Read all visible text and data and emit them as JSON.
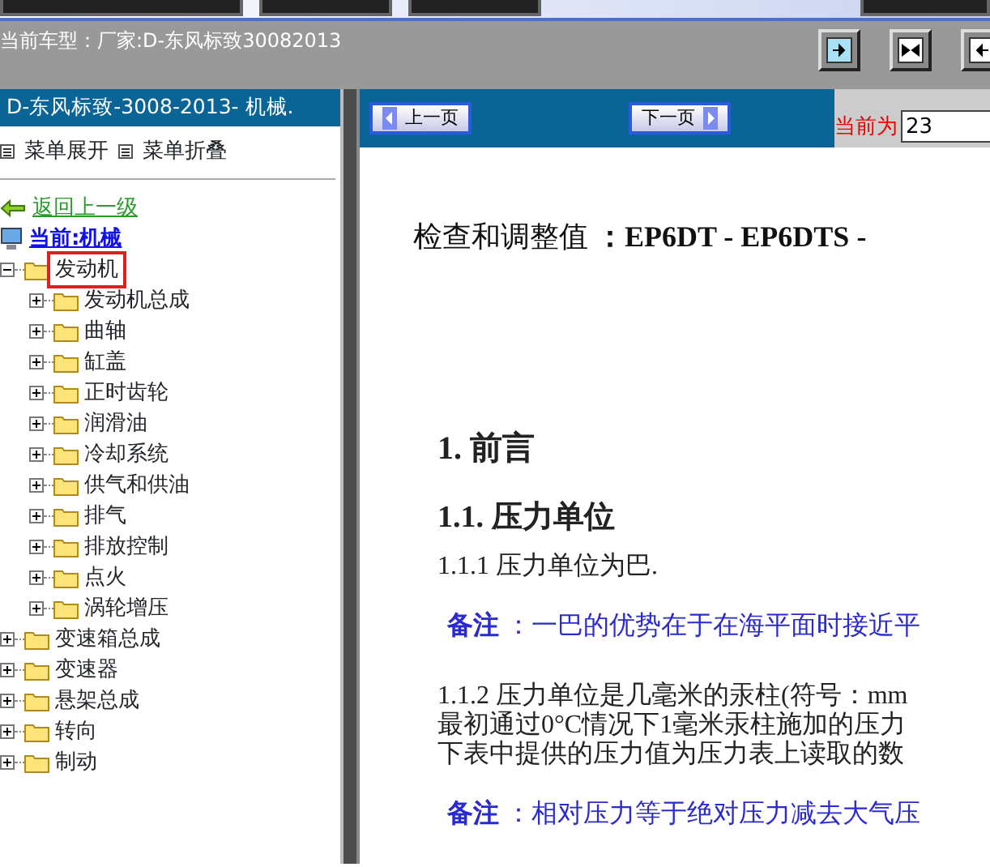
{
  "vehicle_label": "当前车型：厂家:D-东风标致30082013",
  "view_buttons": [
    {
      "kind": "right",
      "selected": true
    },
    {
      "kind": "both",
      "selected": false
    },
    {
      "kind": "left",
      "selected": false
    }
  ],
  "sidebar": {
    "title": "D-东风标致-3008-2013- 机械.",
    "menu_actions": [
      "菜单展开",
      "菜单折叠"
    ],
    "back_link": "返回上一级",
    "current": "当前:机械",
    "tree": [
      {
        "label": "发动机",
        "expanded": true,
        "selected": true,
        "children": [
          {
            "label": "发动机总成",
            "expanded": false,
            "selected": false
          },
          {
            "label": "曲轴",
            "expanded": false,
            "selected": false
          },
          {
            "label": "缸盖",
            "expanded": false,
            "selected": false
          },
          {
            "label": "正时齿轮",
            "expanded": false,
            "selected": false
          },
          {
            "label": "润滑油",
            "expanded": false,
            "selected": false
          },
          {
            "label": "冷却系统",
            "expanded": false,
            "selected": false
          },
          {
            "label": "供气和供油",
            "expanded": false,
            "selected": false
          },
          {
            "label": "排气",
            "expanded": false,
            "selected": false
          },
          {
            "label": "排放控制",
            "expanded": false,
            "selected": false
          },
          {
            "label": "点火",
            "expanded": false,
            "selected": false
          },
          {
            "label": "涡轮增压",
            "expanded": false,
            "selected": false
          }
        ]
      },
      {
        "label": "变速箱总成",
        "expanded": false,
        "selected": false
      },
      {
        "label": "变速器",
        "expanded": false,
        "selected": false
      },
      {
        "label": "悬架总成",
        "expanded": false,
        "selected": false
      },
      {
        "label": "转向",
        "expanded": false,
        "selected": false
      },
      {
        "label": "制动",
        "expanded": false,
        "selected": false
      }
    ]
  },
  "pager": {
    "prev": "上一页",
    "next": "下一页",
    "current_label": "当前为",
    "current_value": "23"
  },
  "document": [
    {
      "kind": "title",
      "text": "检查和调整值 **：EP6DT - EP6DTS -**"
    },
    {
      "kind": "h1",
      "text": "1. 前言"
    },
    {
      "kind": "h2",
      "text": "1.1. 压力单位"
    },
    {
      "kind": "text",
      "text": "1.1.1 压力单位为巴."
    },
    {
      "kind": "note",
      "text": "**备注** ：一巴的优势在于在海平面时接近平"
    },
    {
      "kind": "lines",
      "lines": [
        "1.1.2 压力单位是几毫米的汞柱(符号：mm",
        "最初通过0°C情况下1毫米汞柱施加的压力",
        "下表中提供的压力值为压力表上读取的数"
      ]
    },
    {
      "kind": "note",
      "text": "**备注** ：相对压力等于绝对压力减去大气压"
    }
  ]
}
